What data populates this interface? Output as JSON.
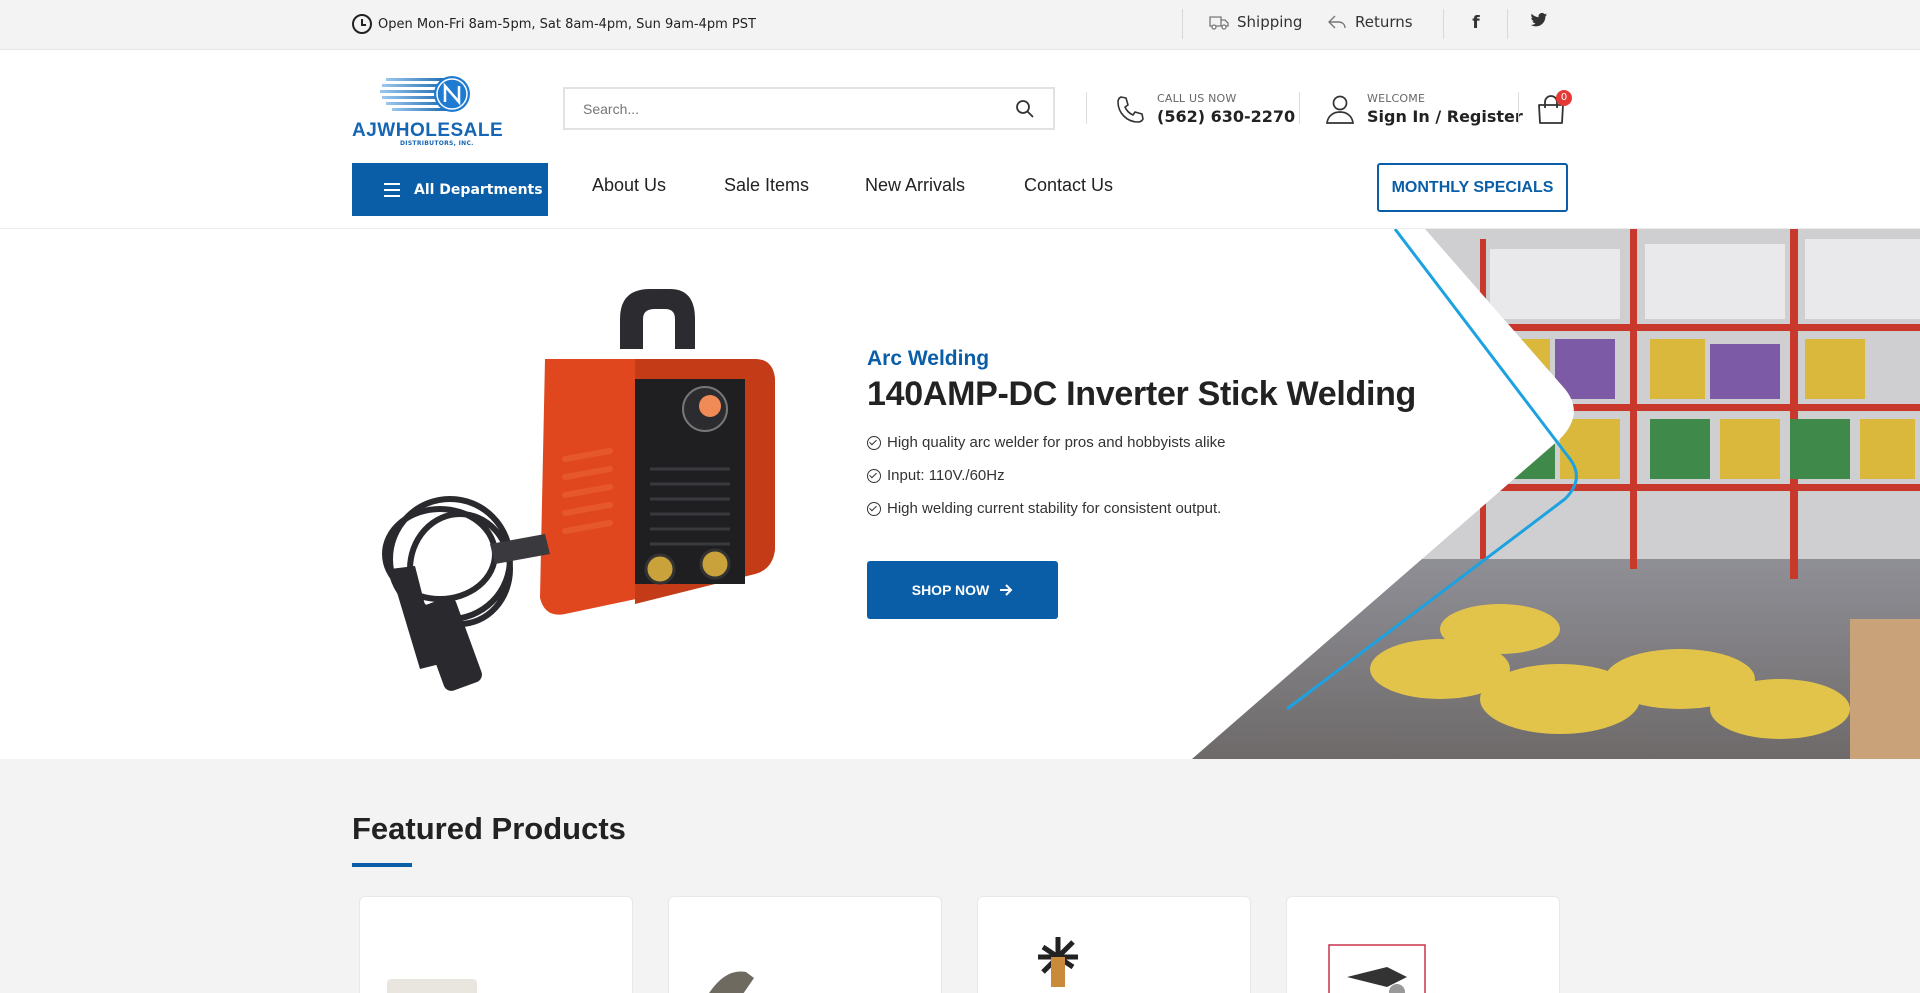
{
  "topbar": {
    "hours": "Open Mon-Fri 8am-5pm, Sat 8am-4pm, Sun 9am-4pm PST",
    "shipping_label": "Shipping",
    "returns_label": "Returns",
    "facebook_glyph": "f",
    "twitter_glyph": "🐦"
  },
  "header": {
    "logo_text": "AJWHOLESALE",
    "logo_subtext": "DISTRIBUTORS, INC.",
    "search_placeholder": "Search...",
    "call_label": "CALL US NOW",
    "phone": "(562) 630-2270",
    "welcome_label": "WELCOME",
    "signin_label": "Sign In / Register",
    "cart_count": "0"
  },
  "nav": {
    "departments_label": "All Departments",
    "links": [
      "About Us",
      "Sale Items",
      "New Arrivals",
      "Contact Us"
    ],
    "monthly_label": "MONTHLY SPECIALS"
  },
  "hero": {
    "category": "Arc Welding",
    "title": "140AMP-DC Inverter Stick Welding",
    "features": [
      "High quality arc welder for pros and hobbyists alike",
      "Input: 110V./60Hz",
      "High welding current stability for consistent output."
    ],
    "cta_label": "SHOP NOW",
    "accent_color": "#0a5ea8"
  },
  "featured": {
    "title": "Featured Products"
  }
}
